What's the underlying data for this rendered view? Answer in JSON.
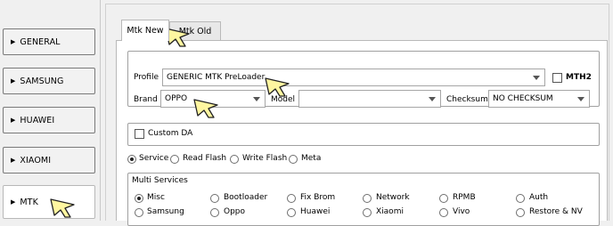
{
  "sidebar": {
    "items": [
      {
        "label": "GENERAL"
      },
      {
        "label": "SAMSUNG"
      },
      {
        "label": "HUAWEI"
      },
      {
        "label": "XIAOMI"
      },
      {
        "label": "MTK"
      }
    ]
  },
  "tabs": [
    {
      "label": "Mtk New",
      "active": true
    },
    {
      "label": "Mtk Old",
      "active": false
    }
  ],
  "form": {
    "profile_label": "Profile",
    "profile_value": "GENERIC MTK PreLoader",
    "mth2_label": "MTH2",
    "brand_label": "Brand",
    "brand_value": "OPPO",
    "model_label": "Model",
    "model_value": "",
    "checksum_label": "Checksum",
    "checksum_value": "NO CHECKSUM",
    "custom_da_label": "Custom DA"
  },
  "modes": [
    {
      "label": "Service",
      "selected": true
    },
    {
      "label": "Read Flash",
      "selected": false
    },
    {
      "label": "Write Flash",
      "selected": false
    },
    {
      "label": "Meta",
      "selected": false
    }
  ],
  "multi_services": {
    "title": "Multi Services",
    "row1": [
      {
        "label": "Misc",
        "selected": true
      },
      {
        "label": "Bootloader",
        "selected": false
      },
      {
        "label": "Fix Brom",
        "selected": false
      },
      {
        "label": "Network",
        "selected": false
      },
      {
        "label": "RPMB",
        "selected": false
      },
      {
        "label": "Auth",
        "selected": false
      }
    ],
    "row2": [
      {
        "label": "Samsung",
        "selected": false
      },
      {
        "label": "Oppo",
        "selected": false
      },
      {
        "label": "Huawei",
        "selected": false
      },
      {
        "label": "Xiaomi",
        "selected": false
      },
      {
        "label": "Vivo",
        "selected": false
      },
      {
        "label": "Restore & NV",
        "selected": false
      }
    ]
  },
  "colors": {
    "cursor_fill": "#fff6a0",
    "cursor_stroke": "#222222"
  }
}
